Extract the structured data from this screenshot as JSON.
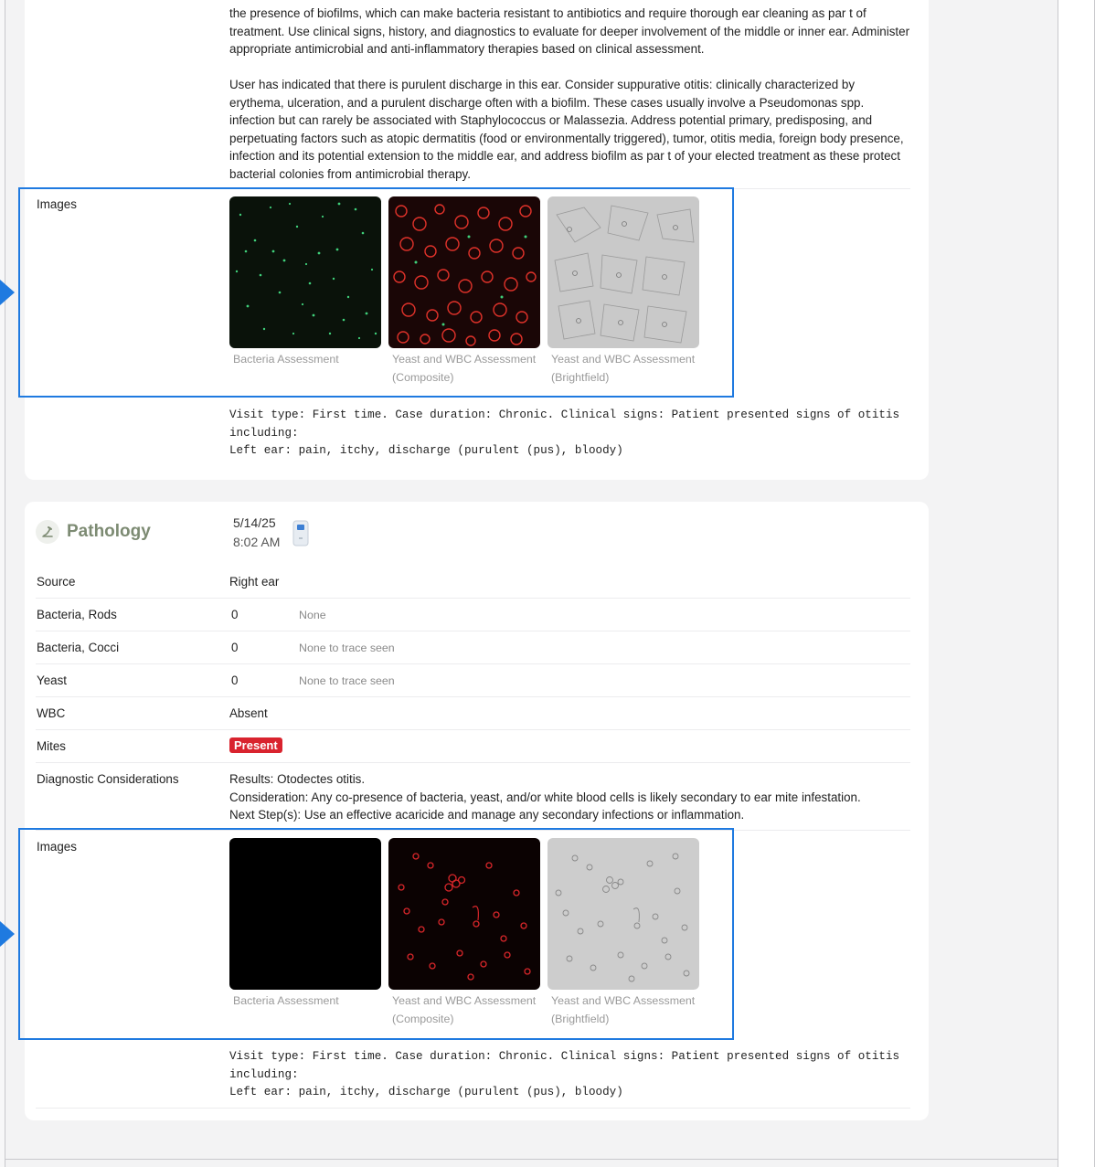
{
  "card1": {
    "diag_para1": "the presence of biofilms, which can make bacteria resistant to antibiotics and require thorough ear cleaning as par t of treatment. Use clinical signs, history, and diagnostics to evaluate for deeper involvement of the middle or inner ear. Administer appropriate antimicrobial and anti-inflammatory therapies based on clinical assessment.",
    "diag_para2": "User has indicated that there is purulent discharge in this ear. Consider suppurative otitis: clinically characterized by erythema, ulceration, and a purulent discharge often with a biofilm. These cases usually involve a Pseudomonas spp. infection but can rarely be associated with Staphylococcus or Malassezia. Address potential primary, predisposing, and perpetuating factors such as atopic dermatitis (food or environmentally triggered), tumor, otitis media, foreign body presence, infection and its potential extension to the middle ear, and address biofilm as par t of your elected treatment as these protect bacterial colonies from antimicrobial therapy.",
    "images_label": "Images",
    "images": [
      {
        "caption": "Bacteria Assessment"
      },
      {
        "caption": "Yeast and WBC Assessment (Composite)"
      },
      {
        "caption": "Yeast and WBC Assessment (Brightfield)"
      }
    ],
    "notes": "Visit type: First time. Case duration: Chronic. Clinical signs: Patient presented signs of otitis including:\nLeft ear: pain, itchy, discharge (purulent (pus), bloody)"
  },
  "card2": {
    "title": "Pathology",
    "date": "5/14/25",
    "time": "8:02 AM",
    "rows": [
      {
        "label": "Source",
        "value": "Right ear",
        "sub": ""
      },
      {
        "label": "Bacteria, Rods",
        "value": "0",
        "sub": "None"
      },
      {
        "label": "Bacteria, Cocci",
        "value": "0",
        "sub": "None to trace seen"
      },
      {
        "label": "Yeast",
        "value": "0",
        "sub": "None to trace seen"
      },
      {
        "label": "WBC",
        "value": "Absent",
        "sub": ""
      },
      {
        "label": "Mites",
        "value": "Present",
        "sub": ""
      }
    ],
    "diag_label": "Diagnostic Considerations",
    "diag_lines": [
      "Results: Otodectes otitis.",
      "Consideration: Any co-presence of bacteria, yeast, and/or white blood cells is likely secondary to ear mite infestation.",
      "Next Step(s): Use an effective acaricide and manage any secondary infections or inflammation."
    ],
    "images_label": "Images",
    "images": [
      {
        "caption": "Bacteria Assessment"
      },
      {
        "caption": "Yeast and WBC Assessment (Composite)"
      },
      {
        "caption": "Yeast and WBC Assessment (Brightfield)"
      }
    ],
    "notes": "Visit type: First time. Case duration: Chronic. Clinical signs: Patient presented signs of otitis including:\nLeft ear: pain, itchy, discharge (purulent (pus), bloody)"
  },
  "colors": {
    "highlight": "#1f7ae0",
    "mites_badge": "#d9232e",
    "pathology_title": "#7d8b73"
  },
  "icons": {
    "pathology": "microscope-icon",
    "device": "analyzer-device-icon",
    "pointer": "arrow-right-pointer-icon"
  }
}
